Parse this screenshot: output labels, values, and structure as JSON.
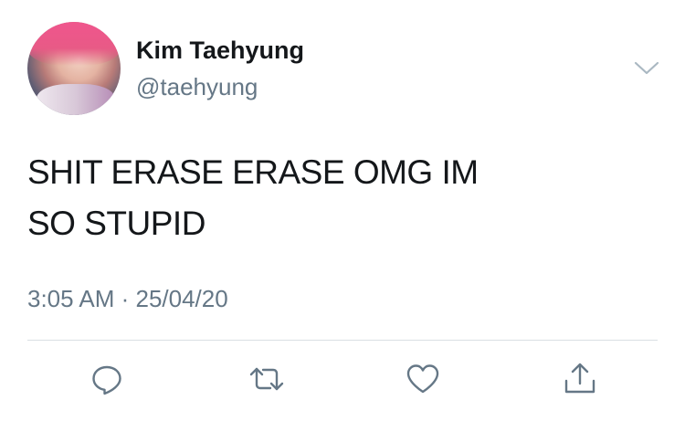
{
  "tweet": {
    "author": {
      "name": "Kim Taehyung",
      "handle": "@taehyung"
    },
    "text_lines": [
      "SHIT ERASE ERASE OMG IM",
      "SO STUPID"
    ],
    "timestamp": "3:05 AM · 25/04/20",
    "actions": {
      "reply_icon": "reply-icon",
      "retweet_icon": "retweet-icon",
      "like_icon": "heart-icon",
      "share_icon": "share-icon"
    },
    "colors": {
      "text": "#14171a",
      "secondary": "#657786",
      "icon": "#657786",
      "divider": "#d9dfe4"
    }
  }
}
